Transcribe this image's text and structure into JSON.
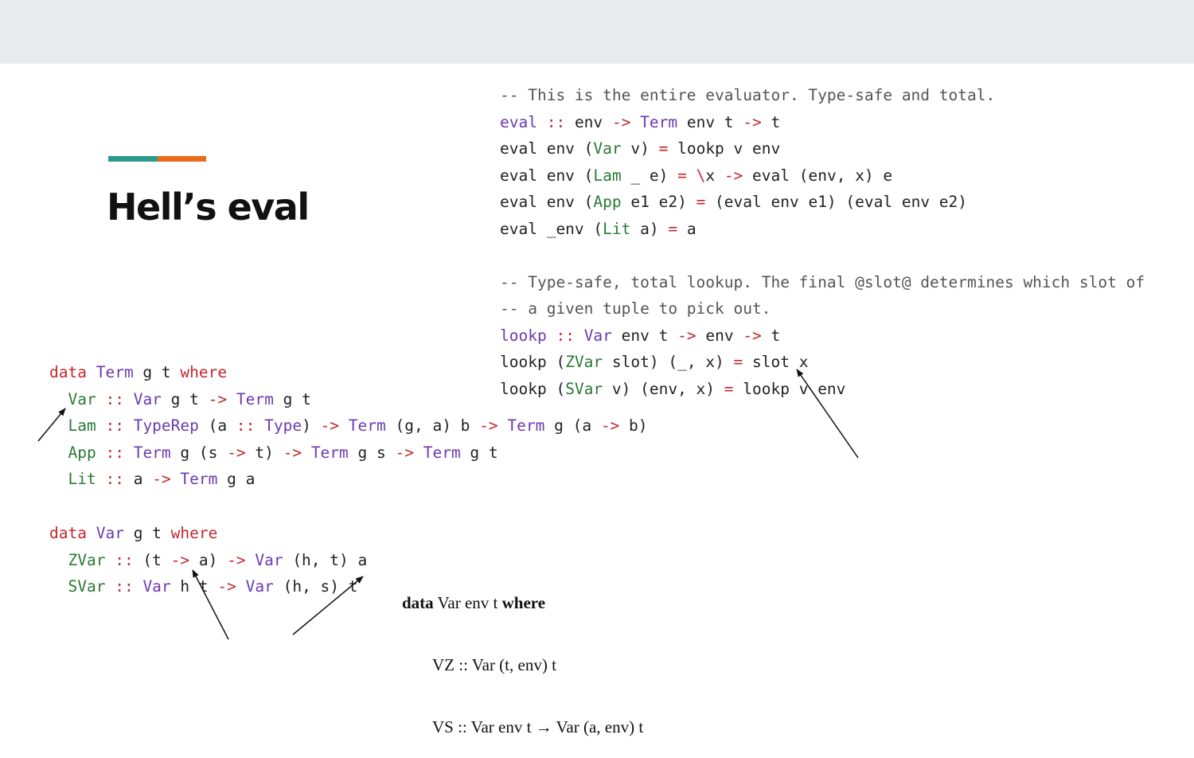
{
  "slide": {
    "title": "Hell’s eval",
    "accent_colors": [
      "#2a9a8c",
      "#ec6a1c"
    ]
  },
  "evaluator": {
    "lines": [
      [
        {
          "s": "cm",
          "t": "-- This is the entire evaluator. Type-safe and total."
        }
      ],
      [
        {
          "s": "t",
          "t": "eval"
        },
        {
          "s": "",
          "t": " "
        },
        {
          "s": "k",
          "t": "::"
        },
        {
          "s": "",
          "t": " env "
        },
        {
          "s": "k",
          "t": "->"
        },
        {
          "s": "",
          "t": " "
        },
        {
          "s": "t",
          "t": "Term"
        },
        {
          "s": "",
          "t": " env t "
        },
        {
          "s": "k",
          "t": "->"
        },
        {
          "s": "",
          "t": " t"
        }
      ],
      [
        {
          "s": "",
          "t": "eval env ("
        },
        {
          "s": "c",
          "t": "Var"
        },
        {
          "s": "",
          "t": " v) "
        },
        {
          "s": "k",
          "t": "="
        },
        {
          "s": "",
          "t": " lookp v env"
        }
      ],
      [
        {
          "s": "",
          "t": "eval env ("
        },
        {
          "s": "c",
          "t": "Lam"
        },
        {
          "s": "",
          "t": " _ e) "
        },
        {
          "s": "k",
          "t": "="
        },
        {
          "s": "",
          "t": " "
        },
        {
          "s": "k",
          "t": "\\"
        },
        {
          "s": "",
          "t": "x "
        },
        {
          "s": "k",
          "t": "->"
        },
        {
          "s": "",
          "t": " eval (env, x) e"
        }
      ],
      [
        {
          "s": "",
          "t": "eval env ("
        },
        {
          "s": "c",
          "t": "App"
        },
        {
          "s": "",
          "t": " e1 e2) "
        },
        {
          "s": "k",
          "t": "="
        },
        {
          "s": "",
          "t": " (eval env e1) (eval env e2)"
        }
      ],
      [
        {
          "s": "",
          "t": "eval _env ("
        },
        {
          "s": "c",
          "t": "Lit"
        },
        {
          "s": "",
          "t": " a) "
        },
        {
          "s": "k",
          "t": "="
        },
        {
          "s": "",
          "t": " a"
        }
      ],
      [
        {
          "s": "",
          "t": " "
        }
      ],
      [
        {
          "s": "cm",
          "t": "-- Type-safe, total lookup. The final @slot@ determines which slot of"
        }
      ],
      [
        {
          "s": "cm",
          "t": "-- a given tuple to pick out."
        }
      ],
      [
        {
          "s": "t",
          "t": "lookp"
        },
        {
          "s": "",
          "t": " "
        },
        {
          "s": "k",
          "t": "::"
        },
        {
          "s": "",
          "t": " "
        },
        {
          "s": "t",
          "t": "Var"
        },
        {
          "s": "",
          "t": " env t "
        },
        {
          "s": "k",
          "t": "->"
        },
        {
          "s": "",
          "t": " env "
        },
        {
          "s": "k",
          "t": "->"
        },
        {
          "s": "",
          "t": " t"
        }
      ],
      [
        {
          "s": "",
          "t": "lookp ("
        },
        {
          "s": "c",
          "t": "ZVar"
        },
        {
          "s": "",
          "t": " slot) (_, x) "
        },
        {
          "s": "k",
          "t": "="
        },
        {
          "s": "",
          "t": " slot x"
        }
      ],
      [
        {
          "s": "",
          "t": "lookp ("
        },
        {
          "s": "c",
          "t": "SVar"
        },
        {
          "s": "",
          "t": " v) (env, x) "
        },
        {
          "s": "k",
          "t": "="
        },
        {
          "s": "",
          "t": " lookp v env"
        }
      ]
    ]
  },
  "term_def": {
    "lines": [
      [
        {
          "s": "k",
          "t": "data"
        },
        {
          "s": "",
          "t": " "
        },
        {
          "s": "t",
          "t": "Term"
        },
        {
          "s": "",
          "t": " g t "
        },
        {
          "s": "k",
          "t": "where"
        }
      ],
      [
        {
          "s": "",
          "t": "  "
        },
        {
          "s": "c",
          "t": "Var"
        },
        {
          "s": "",
          "t": " "
        },
        {
          "s": "k",
          "t": "::"
        },
        {
          "s": "",
          "t": " "
        },
        {
          "s": "t",
          "t": "Var"
        },
        {
          "s": "",
          "t": " g t "
        },
        {
          "s": "k",
          "t": "->"
        },
        {
          "s": "",
          "t": " "
        },
        {
          "s": "t",
          "t": "Term"
        },
        {
          "s": "",
          "t": " g t"
        }
      ],
      [
        {
          "s": "",
          "t": "  "
        },
        {
          "s": "c",
          "t": "Lam"
        },
        {
          "s": "",
          "t": " "
        },
        {
          "s": "k",
          "t": "::"
        },
        {
          "s": "",
          "t": " "
        },
        {
          "s": "t",
          "t": "TypeRep"
        },
        {
          "s": "",
          "t": " (a "
        },
        {
          "s": "k",
          "t": "::"
        },
        {
          "s": "",
          "t": " "
        },
        {
          "s": "t",
          "t": "Type"
        },
        {
          "s": "",
          "t": ") "
        },
        {
          "s": "k",
          "t": "->"
        },
        {
          "s": "",
          "t": " "
        },
        {
          "s": "t",
          "t": "Term"
        },
        {
          "s": "",
          "t": " (g, a) b "
        },
        {
          "s": "k",
          "t": "->"
        },
        {
          "s": "",
          "t": " "
        },
        {
          "s": "t",
          "t": "Term"
        },
        {
          "s": "",
          "t": " g (a "
        },
        {
          "s": "k",
          "t": "->"
        },
        {
          "s": "",
          "t": " b)"
        }
      ],
      [
        {
          "s": "",
          "t": "  "
        },
        {
          "s": "c",
          "t": "App"
        },
        {
          "s": "",
          "t": " "
        },
        {
          "s": "k",
          "t": "::"
        },
        {
          "s": "",
          "t": " "
        },
        {
          "s": "t",
          "t": "Term"
        },
        {
          "s": "",
          "t": " g (s "
        },
        {
          "s": "k",
          "t": "->"
        },
        {
          "s": "",
          "t": " t) "
        },
        {
          "s": "k",
          "t": "->"
        },
        {
          "s": "",
          "t": " "
        },
        {
          "s": "t",
          "t": "Term"
        },
        {
          "s": "",
          "t": " g s "
        },
        {
          "s": "k",
          "t": "->"
        },
        {
          "s": "",
          "t": " "
        },
        {
          "s": "t",
          "t": "Term"
        },
        {
          "s": "",
          "t": " g t"
        }
      ],
      [
        {
          "s": "",
          "t": "  "
        },
        {
          "s": "c",
          "t": "Lit"
        },
        {
          "s": "",
          "t": " "
        },
        {
          "s": "k",
          "t": "::"
        },
        {
          "s": "",
          "t": " a "
        },
        {
          "s": "k",
          "t": "->"
        },
        {
          "s": "",
          "t": " "
        },
        {
          "s": "t",
          "t": "Term"
        },
        {
          "s": "",
          "t": " g a"
        }
      ]
    ]
  },
  "var_def": {
    "lines": [
      [
        {
          "s": "k",
          "t": "data"
        },
        {
          "s": "",
          "t": " "
        },
        {
          "s": "t",
          "t": "Var"
        },
        {
          "s": "",
          "t": " g t "
        },
        {
          "s": "k",
          "t": "where"
        }
      ],
      [
        {
          "s": "",
          "t": "  "
        },
        {
          "s": "c",
          "t": "ZVar"
        },
        {
          "s": "",
          "t": " "
        },
        {
          "s": "k",
          "t": "::"
        },
        {
          "s": "",
          "t": " (t "
        },
        {
          "s": "k",
          "t": "->"
        },
        {
          "s": "",
          "t": " a) "
        },
        {
          "s": "k",
          "t": "->"
        },
        {
          "s": "",
          "t": " "
        },
        {
          "s": "t",
          "t": "Var"
        },
        {
          "s": "",
          "t": " (h, t) a"
        }
      ],
      [
        {
          "s": "",
          "t": "  "
        },
        {
          "s": "c",
          "t": "SVar"
        },
        {
          "s": "",
          "t": " "
        },
        {
          "s": "k",
          "t": "::"
        },
        {
          "s": "",
          "t": " "
        },
        {
          "s": "t",
          "t": "Var"
        },
        {
          "s": "",
          "t": " h t "
        },
        {
          "s": "k",
          "t": "->"
        },
        {
          "s": "",
          "t": " "
        },
        {
          "s": "t",
          "t": "Var"
        },
        {
          "s": "",
          "t": " (h, s) t"
        }
      ]
    ]
  },
  "math_def": {
    "kw_data": "data",
    "head": " Var env t ",
    "kw_where": "where",
    "vz": "VZ :: Var (t, env) t",
    "vs": "VS :: Var env t → Var (a, env) t"
  }
}
